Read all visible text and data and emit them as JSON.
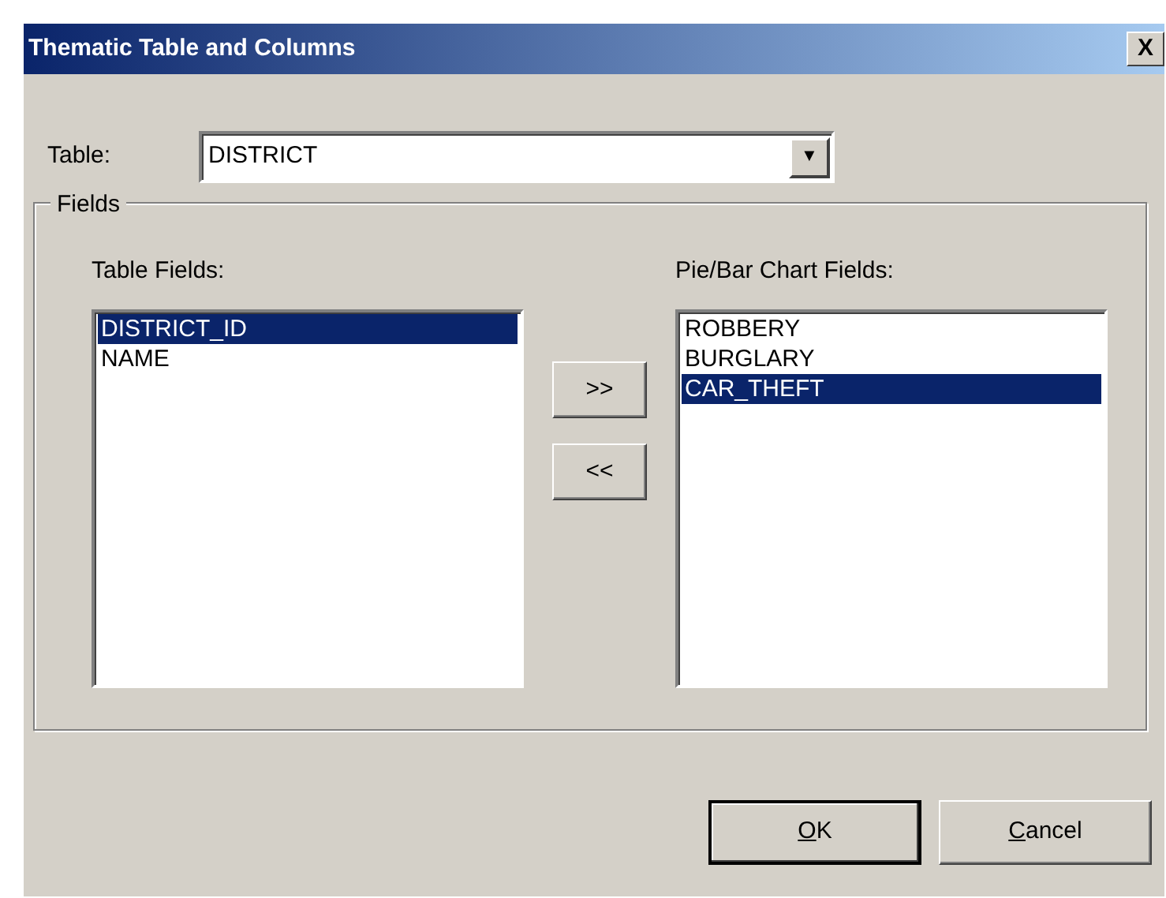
{
  "window": {
    "title": "Thematic Table and Columns",
    "close": "X"
  },
  "table": {
    "label": "Table:",
    "value": "DISTRICT",
    "arrow": "▼"
  },
  "fields": {
    "legend": "Fields",
    "table_fields": {
      "label": "Table Fields:",
      "items": [
        {
          "text": "DISTRICT_ID",
          "selected": true
        },
        {
          "text": "NAME",
          "selected": false
        }
      ]
    },
    "move_buttons": [
      ">>",
      "<<"
    ],
    "chart_fields": {
      "label": "Pie/Bar Chart Fields:",
      "items": [
        {
          "text": "ROBBERY",
          "selected": false
        },
        {
          "text": "BURGLARY",
          "selected": false
        },
        {
          "text": "CAR_THEFT",
          "selected": true
        }
      ]
    }
  },
  "buttons": [
    {
      "label_underlined": "O",
      "label_rest": "K",
      "default": true
    },
    {
      "label_underlined": "C",
      "label_rest": "ancel",
      "default": false
    }
  ]
}
